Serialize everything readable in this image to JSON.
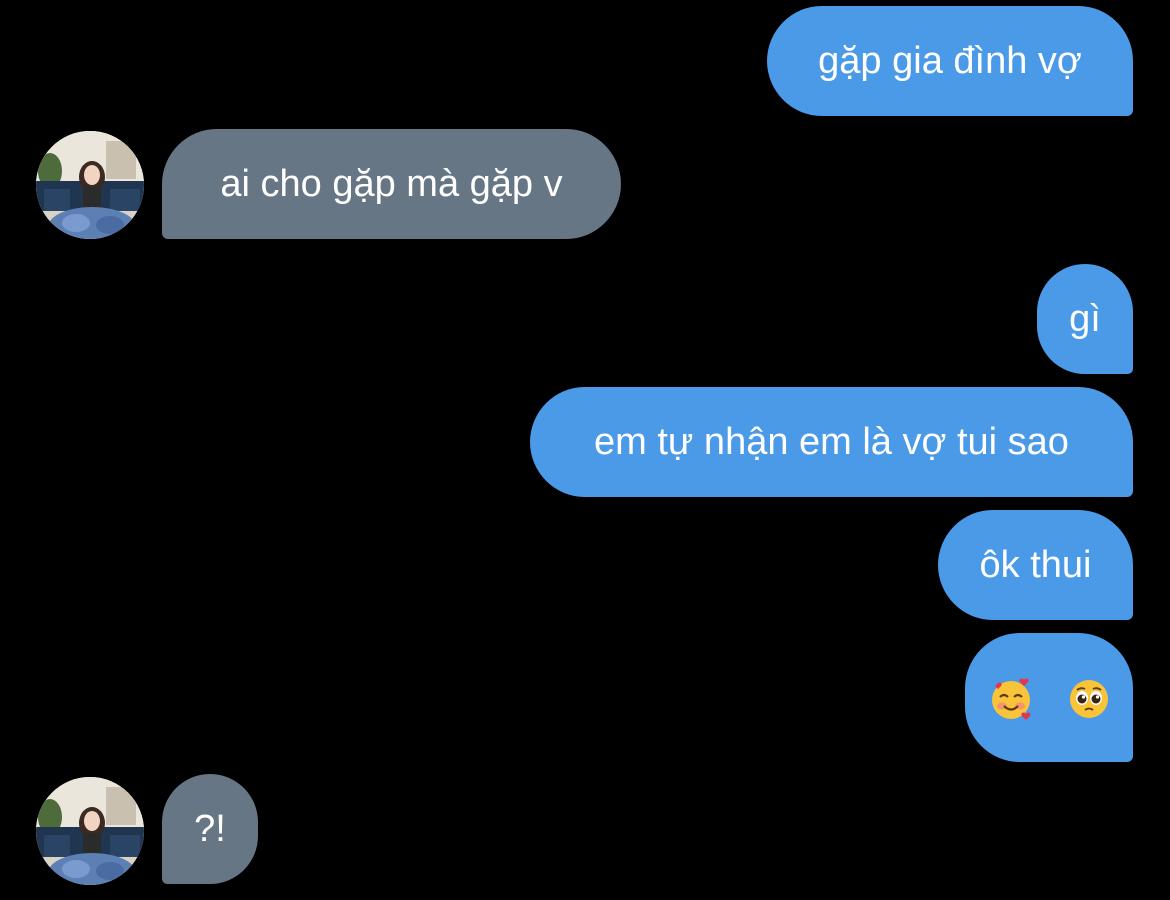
{
  "colors": {
    "background": "#000000",
    "outgoing_bubble": "#4a9ae8",
    "incoming_bubble": "#677684",
    "text": "#ffffff"
  },
  "messages": [
    {
      "direction": "outgoing",
      "text": "gặp gia đình vợ"
    },
    {
      "direction": "incoming",
      "text": "ai cho gặp mà gặp v",
      "avatar": "contact-avatar"
    },
    {
      "direction": "outgoing",
      "text": "gì"
    },
    {
      "direction": "outgoing",
      "text": "em tự nhận em là vợ tui sao"
    },
    {
      "direction": "outgoing",
      "text": "ôk thui"
    },
    {
      "direction": "outgoing",
      "emojis": [
        "smiling-face-with-hearts",
        "pleading-face"
      ]
    },
    {
      "direction": "incoming",
      "text": "?!",
      "avatar": "contact-avatar"
    }
  ]
}
